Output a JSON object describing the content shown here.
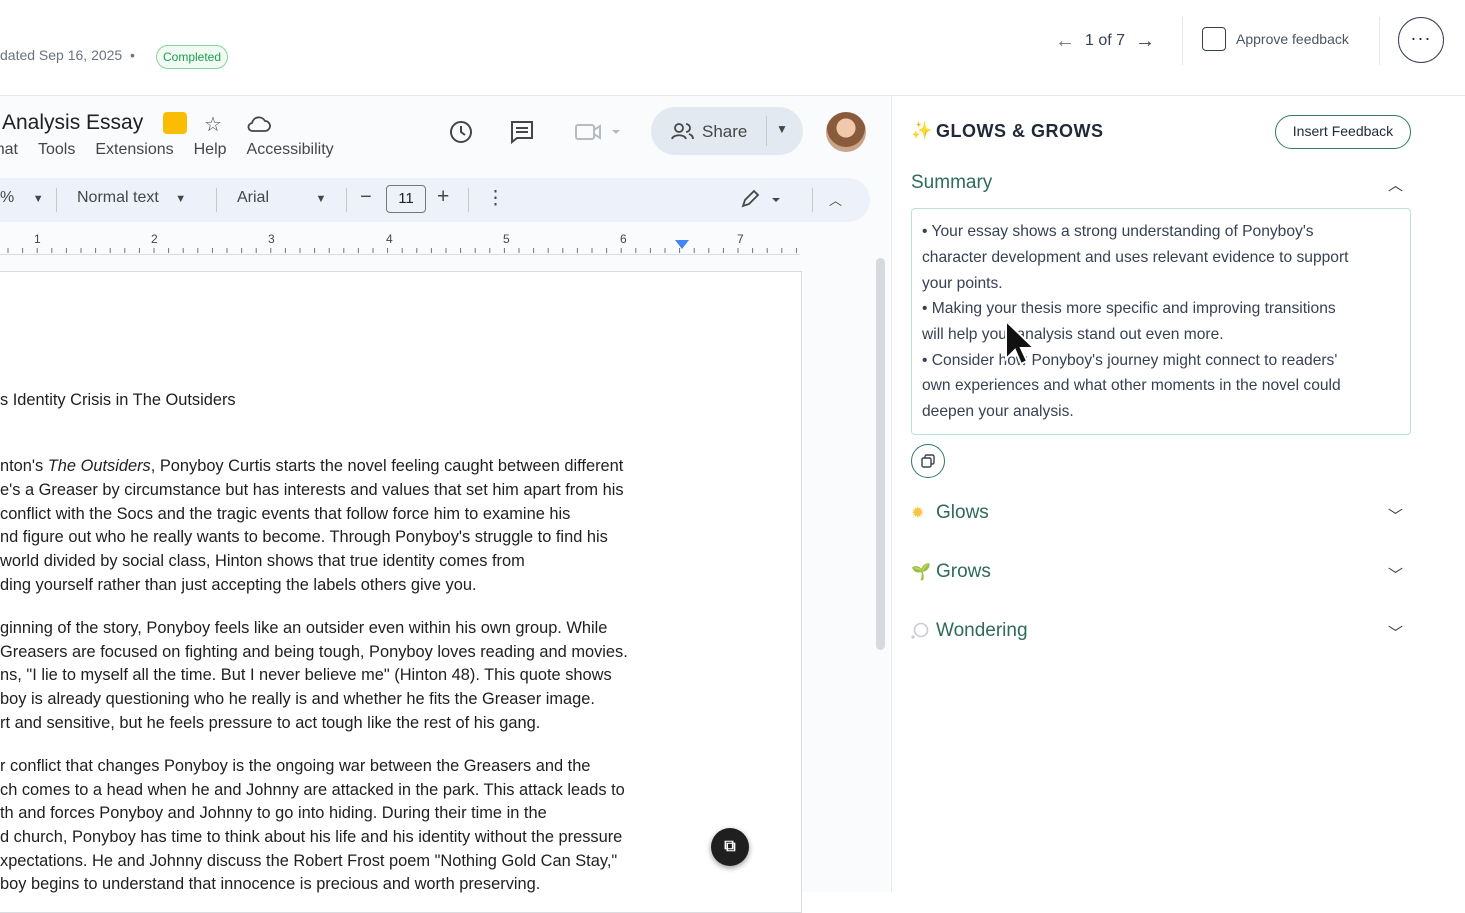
{
  "header": {
    "updated_text": "dated Sep 16, 2025",
    "separator": "•",
    "status_badge": "Completed",
    "pager_text": "1 of 7",
    "approve_label": "Approve feedback",
    "more_label": "···"
  },
  "docs": {
    "title": "Analysis Essay",
    "menus": [
      "rmat",
      "Tools",
      "Extensions",
      "Help",
      "Accessibility"
    ],
    "share_label": "Share",
    "toolbar": {
      "zoom": "%",
      "style": "Normal text",
      "font": "Arial",
      "minus": "−",
      "font_size": "11",
      "plus": "+",
      "kebab": "⋮"
    },
    "ruler_numbers": [
      "1",
      "2",
      "3",
      "4",
      "5",
      "6",
      "7"
    ],
    "paragraphs": [
      [
        "s Identity Crisis in The Outsiders"
      ],
      [
        "nton's The Outsiders, Ponyboy Curtis starts the novel feeling caught between different",
        "e's a Greaser by circumstance but has interests and values that set him apart from his",
        " conflict with the Socs and the tragic events that follow force him to examine his",
        "nd figure out who he really wants to become. Through Ponyboy's struggle to find his",
        " world divided by social class, Hinton shows that true identity comes from",
        "ding yourself rather than just accepting the labels others give you."
      ],
      [
        "ginning of the story, Ponyboy feels like an outsider even within his own group. While",
        "Greasers are focused on fighting and being tough, Ponyboy loves reading and movies.",
        "ns, \"I lie to myself all the time. But I never believe me\" (Hinton 48). This quote shows",
        "boy is already questioning who he really is and whether he fits the Greaser image.",
        "rt and sensitive, but he feels pressure to act tough like the rest of his gang."
      ],
      [
        "r conflict that changes Ponyboy is the ongoing war between the Greasers and the",
        "ch comes to a head when he and Johnny are attacked in the park. This attack leads to",
        "th and forces Ponyboy and Johnny to go into hiding. During their time in the",
        "d church, Ponyboy has time to think about his life and his identity without the pressure",
        "xpectations. He and Johnny discuss the Robert Frost poem \"Nothing Gold Can Stay,\"",
        "boy begins to understand that innocence is precious and worth preserving."
      ]
    ],
    "fab_label": "⧉"
  },
  "panel": {
    "title": "GLOWS & GROWS",
    "insert_label": "Insert Feedback",
    "summary_label": "Summary",
    "summary_lines": [
      "• Your essay shows a strong understanding of Ponyboy's",
      "character development and uses relevant evidence to support",
      "your points.",
      "• Making your thesis more specific and improving transitions",
      "will help your analysis stand out even more.",
      "• Consider how Ponyboy's journey might connect to readers'",
      "own experiences and what other moments in the novel could",
      "deepen your analysis."
    ],
    "sections": [
      {
        "label": "Glows",
        "icon": "sun-icon"
      },
      {
        "label": "Grows",
        "icon": "sprout-icon"
      },
      {
        "label": "Wondering",
        "icon": "thought-bubble-icon"
      }
    ],
    "accent_color": "#2e6b5a"
  }
}
